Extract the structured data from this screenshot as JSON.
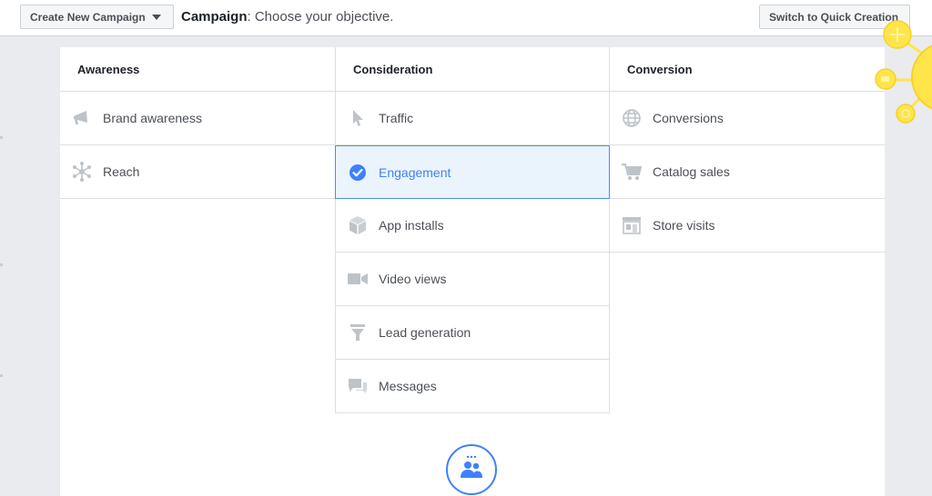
{
  "header": {
    "create_button": "Create New Campaign",
    "title_bold": "Campaign",
    "title_rest": ": Choose your objective.",
    "quick_button": "Switch to Quick Creation"
  },
  "columns": [
    {
      "title": "Awareness",
      "items": [
        {
          "label": "Brand awareness",
          "icon": "megaphone-icon"
        },
        {
          "label": "Reach",
          "icon": "reach-icon"
        }
      ]
    },
    {
      "title": "Consideration",
      "items": [
        {
          "label": "Traffic",
          "icon": "cursor-icon"
        },
        {
          "label": "Engagement",
          "icon": "check-circle-icon",
          "selected": true
        },
        {
          "label": "App installs",
          "icon": "box-icon"
        },
        {
          "label": "Video views",
          "icon": "video-camera-icon"
        },
        {
          "label": "Lead generation",
          "icon": "funnel-icon"
        },
        {
          "label": "Messages",
          "icon": "chat-bubbles-icon"
        }
      ]
    },
    {
      "title": "Conversion",
      "items": [
        {
          "label": "Conversions",
          "icon": "globe-icon"
        },
        {
          "label": "Catalog sales",
          "icon": "shopping-cart-icon"
        },
        {
          "label": "Store visits",
          "icon": "store-icon"
        }
      ]
    }
  ],
  "colors": {
    "accent": "#4080ff",
    "selected_bg": "#ebf4fc",
    "icon_gray": "#bec3c9",
    "sun": "#ffe54a"
  }
}
